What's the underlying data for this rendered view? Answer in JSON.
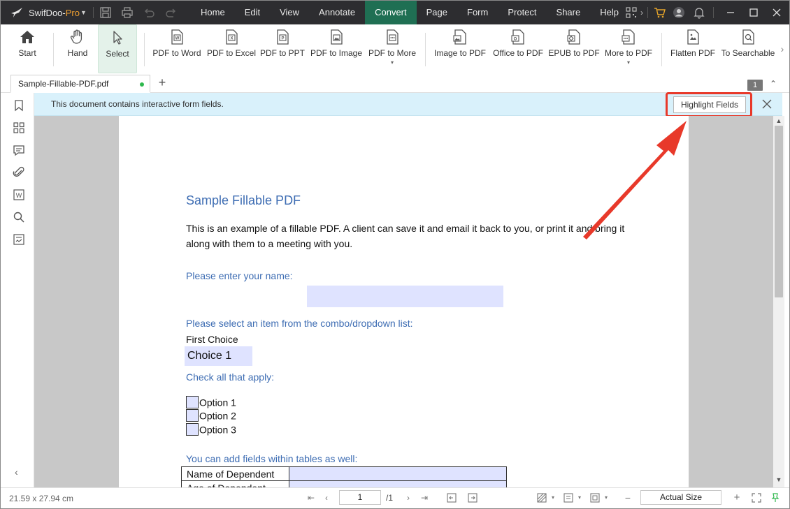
{
  "app": {
    "name_main": "SwifDoo-",
    "name_suffix": "Pro"
  },
  "menu": [
    "Home",
    "Edit",
    "View",
    "Annotate",
    "Convert",
    "Page",
    "Form",
    "Protect",
    "Share",
    "Help"
  ],
  "menu_active": "Convert",
  "toolbar": {
    "start": "Start",
    "hand": "Hand",
    "select": "Select",
    "pdf_to_word": "PDF to Word",
    "pdf_to_excel": "PDF to Excel",
    "pdf_to_ppt": "PDF to PPT",
    "pdf_to_image": "PDF to Image",
    "pdf_to_more": "PDF to More",
    "image_to_pdf": "Image to PDF",
    "office_to_pdf": "Office to PDF",
    "epub_to_pdf": "EPUB to PDF",
    "more_to_pdf": "More to PDF",
    "flatten_pdf": "Flatten PDF",
    "to_searchable": "To Searchable"
  },
  "tab": {
    "filename": "Sample-Fillable-PDF.pdf",
    "add": "+",
    "page_badge": "1"
  },
  "notice": {
    "message": "This document contains interactive form fields.",
    "highlight_button": "Highlight Fields"
  },
  "document": {
    "title": "Sample Fillable PDF",
    "intro": "This is an example of a fillable PDF. A client can save it and email it back to you, or print it and bring it along with them to a meeting with you.",
    "q_name": "Please enter your name:",
    "q_combo": "Please select an item from the combo/dropdown list:",
    "combo_label": "First Choice",
    "combo_value": "Choice 1",
    "q_check": "Check all that apply:",
    "options": [
      "Option 1",
      "Option 2",
      "Option 3"
    ],
    "q_table": "You can add  fields within tables as well:",
    "table_rows": [
      "Name of Dependent",
      "Age of Dependent"
    ]
  },
  "status": {
    "dimensions": "21.59 x 27.94 cm",
    "current_page": "1",
    "total_pages": "/1",
    "zoom": "Actual Size"
  },
  "colors": {
    "titlebar": "#2d2d30",
    "menu_active": "#1f6f53",
    "notice_bg": "#d9f1fb",
    "field_fill": "#dfe3ff",
    "heading_blue": "#3e6db3",
    "annotation_red": "#e8392a"
  }
}
